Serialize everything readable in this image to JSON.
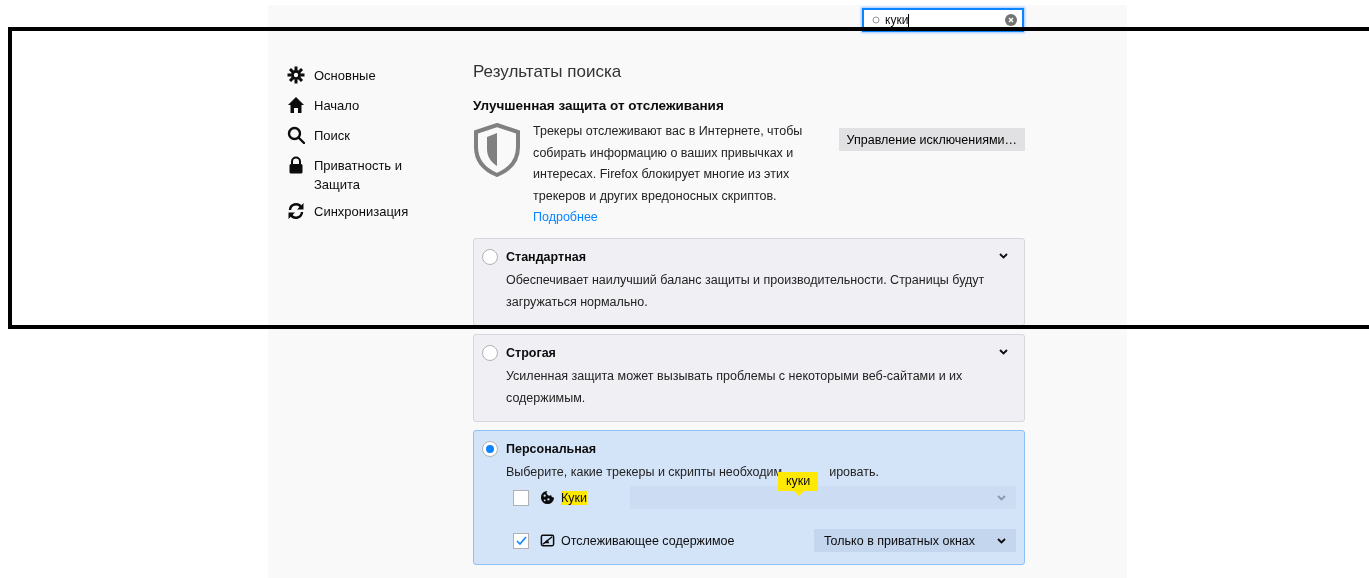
{
  "search": {
    "value": "куки"
  },
  "sidebar": {
    "items": [
      {
        "label": "Основные",
        "selected": false
      },
      {
        "label": "Начало",
        "selected": false
      },
      {
        "label": "Поиск",
        "selected": false
      },
      {
        "label": "Приватность и Защита",
        "selected": false
      },
      {
        "label": "Синхронизация",
        "selected": false
      }
    ]
  },
  "page_title": "Результаты поиска",
  "section": {
    "title": "Улучшенная защита от отслеживания",
    "description": "Трекеры отслеживают вас в Интернете, чтобы собирать информацию о ваших привычках и интересах. Firefox блокирует многие из этих трекеров и других вредоносных скриптов.",
    "link": "Подробнее",
    "button": {
      "label": "Управление исключениями…"
    }
  },
  "options": [
    {
      "title": "Стандартная",
      "selected": false,
      "description": [
        "Обеспечивает наилучший баланс защиты и производительности. Страницы будут загружаться нормально."
      ]
    },
    {
      "title": "Строгая",
      "selected": false,
      "description": [
        "Усиленная защита может вызывать проблемы с некоторыми веб-сайтами и их содержимым."
      ]
    },
    {
      "title": "Персональная",
      "selected": true,
      "description": [
        "Выберите, какие трекеры и скрипты необходим",
        "ировать."
      ],
      "tooltip": "куки",
      "settings": [
        {
          "label": "Куки",
          "checked": false,
          "highlighted": true,
          "dropdown": {
            "disabled": true
          }
        },
        {
          "label": "Отслеживающее содержимое",
          "checked": true,
          "highlighted": false,
          "dropdown": {
            "value": "Только в приватных окнах",
            "disabled": false
          }
        }
      ]
    }
  ]
}
